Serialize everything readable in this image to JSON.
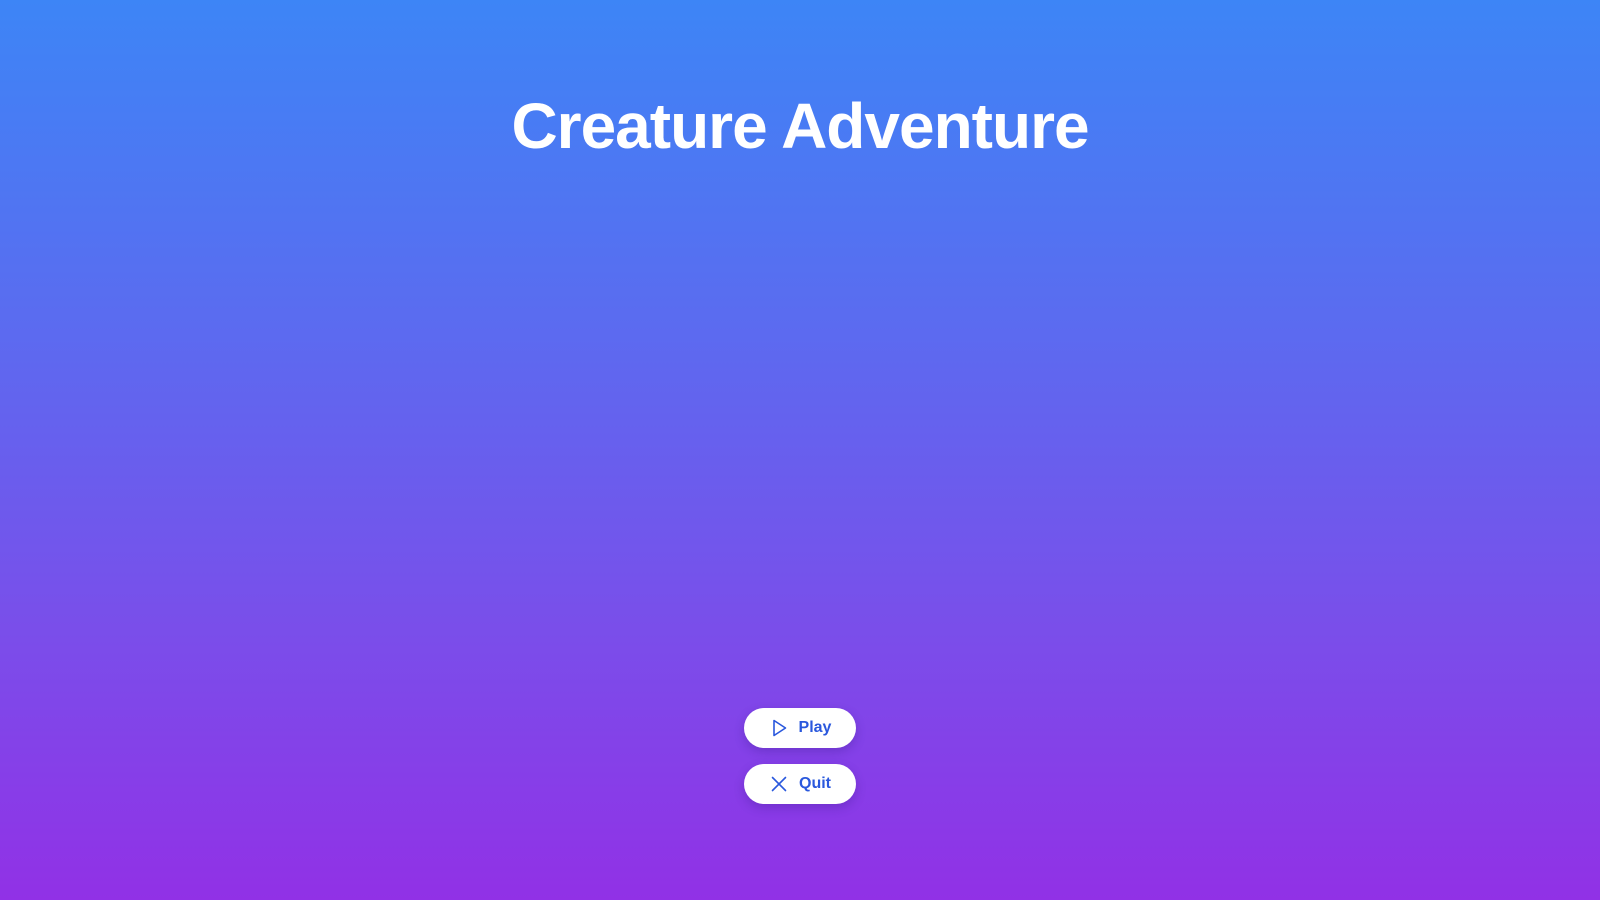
{
  "game": {
    "title": "Creature Adventure"
  },
  "menu": {
    "buttons": [
      {
        "label": "Play",
        "icon": "play-icon"
      },
      {
        "label": "Quit",
        "icon": "close-icon"
      }
    ]
  },
  "colors": {
    "gradient_top": "#3d85f6",
    "gradient_bottom": "#9131e6",
    "button_background": "#ffffff",
    "button_text": "#2a58dd",
    "title_text": "#ffffff"
  }
}
